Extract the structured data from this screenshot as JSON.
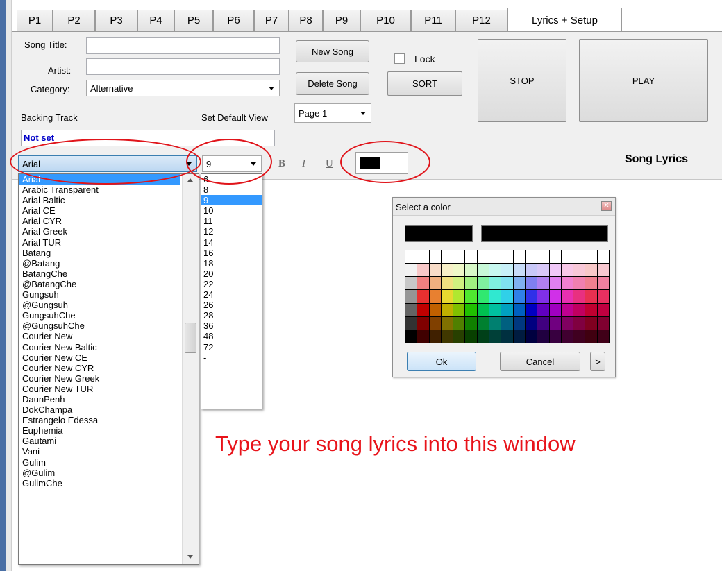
{
  "tabs": [
    "P1",
    "P2",
    "P3",
    "P4",
    "P5",
    "P6",
    "P7",
    "P8",
    "P9",
    "P10",
    "P11",
    "P12",
    "Lyrics + Setup"
  ],
  "active_tab": "Lyrics + Setup",
  "form": {
    "song_title_label": "Song Title:",
    "song_title_value": "",
    "artist_label": "Artist:",
    "artist_value": "",
    "category_label": "Category:",
    "category_value": "Alternative",
    "backing_track_label": "Backing Track",
    "backing_track_value": "Not set",
    "default_view_label": "Set Default View",
    "default_view_value": "Page 1",
    "lock_label": "Lock",
    "lock_checked": false
  },
  "buttons": {
    "new_song": "New Song",
    "delete_song": "Delete Song",
    "sort": "SORT",
    "stop": "STOP",
    "play": "PLAY"
  },
  "format_bar": {
    "font_value": "Arial",
    "size_value": "9",
    "bold": "B",
    "italic": "I",
    "underline": "U",
    "color_value": "#000000",
    "section_title": "Song Lyrics"
  },
  "font_list": [
    "Arial",
    "Arabic Transparent",
    "Arial Baltic",
    "Arial CE",
    "Arial CYR",
    "Arial Greek",
    "Arial TUR",
    "Batang",
    "@Batang",
    "BatangChe",
    "@BatangChe",
    "Gungsuh",
    "@Gungsuh",
    "GungsuhChe",
    "@GungsuhChe",
    "Courier New",
    "Courier New Baltic",
    "Courier New CE",
    "Courier New CYR",
    "Courier New Greek",
    "Courier New TUR",
    "DaunPenh",
    "DokChampa",
    "Estrangelo Edessa",
    "Euphemia",
    "Gautami",
    "Vani",
    "Gulim",
    "@Gulim",
    "GulimChe"
  ],
  "font_list_selected": "Arial",
  "size_list": [
    "6",
    "8",
    "9",
    "10",
    "11",
    "12",
    "14",
    "16",
    "18",
    "20",
    "22",
    "24",
    "26",
    "28",
    "36",
    "48",
    "72",
    "-"
  ],
  "size_list_selected": "9",
  "color_dialog": {
    "title": "Select a color",
    "ok": "Ok",
    "cancel": "Cancel",
    "more": ">",
    "palette_rows": [
      [
        "#ffffff",
        "#ffffff",
        "#ffffff",
        "#ffffff",
        "#ffffff",
        "#ffffff",
        "#ffffff",
        "#ffffff",
        "#ffffff",
        "#ffffff",
        "#ffffff",
        "#ffffff",
        "#ffffff",
        "#ffffff",
        "#ffffff",
        "#ffffff",
        "#ffffff"
      ],
      [
        "#f2f2f2",
        "#f8c8c8",
        "#f8dcc8",
        "#f8f0c8",
        "#f0f8c8",
        "#d8f8c8",
        "#c8f8d8",
        "#c8f8f0",
        "#c8f0f8",
        "#c8dcf8",
        "#c8c8f8",
        "#d8c8f8",
        "#f0c8f8",
        "#f8c8e8",
        "#f8c8d8",
        "#f8c8c8",
        "#f8c8d0"
      ],
      [
        "#c8c8c8",
        "#f08080",
        "#f0b080",
        "#f0e080",
        "#d0f080",
        "#a0f080",
        "#80f0a0",
        "#80f0e0",
        "#80e0f0",
        "#80b0f0",
        "#8080f0",
        "#b080f0",
        "#e080f0",
        "#f080d0",
        "#f080b0",
        "#f08090",
        "#f080a0"
      ],
      [
        "#969696",
        "#e83030",
        "#e88030",
        "#e8d830",
        "#b0e830",
        "#50e830",
        "#30e870",
        "#30e8d0",
        "#30d0e8",
        "#3080e8",
        "#3030e8",
        "#8030e8",
        "#d030e8",
        "#e830b0",
        "#e83080",
        "#e83050",
        "#e83060"
      ],
      [
        "#646464",
        "#c00000",
        "#c06000",
        "#c0b000",
        "#80c000",
        "#20c000",
        "#00c050",
        "#00c0a0",
        "#00a0c0",
        "#0060c0",
        "#0000c0",
        "#6000c0",
        "#a000c0",
        "#c00090",
        "#c00060",
        "#c00030",
        "#c00040"
      ],
      [
        "#323232",
        "#800000",
        "#804000",
        "#807000",
        "#508000",
        "#108000",
        "#008030",
        "#008070",
        "#006080",
        "#003880",
        "#000080",
        "#400080",
        "#700080",
        "#800060",
        "#800040",
        "#800020",
        "#800030"
      ],
      [
        "#000000",
        "#400000",
        "#402000",
        "#403800",
        "#284000",
        "#084000",
        "#004018",
        "#004038",
        "#003040",
        "#001c40",
        "#000040",
        "#200040",
        "#380040",
        "#400030",
        "#400020",
        "#400010",
        "#400018"
      ]
    ]
  },
  "lyrics_hint": "Type your song lyrics into this window"
}
